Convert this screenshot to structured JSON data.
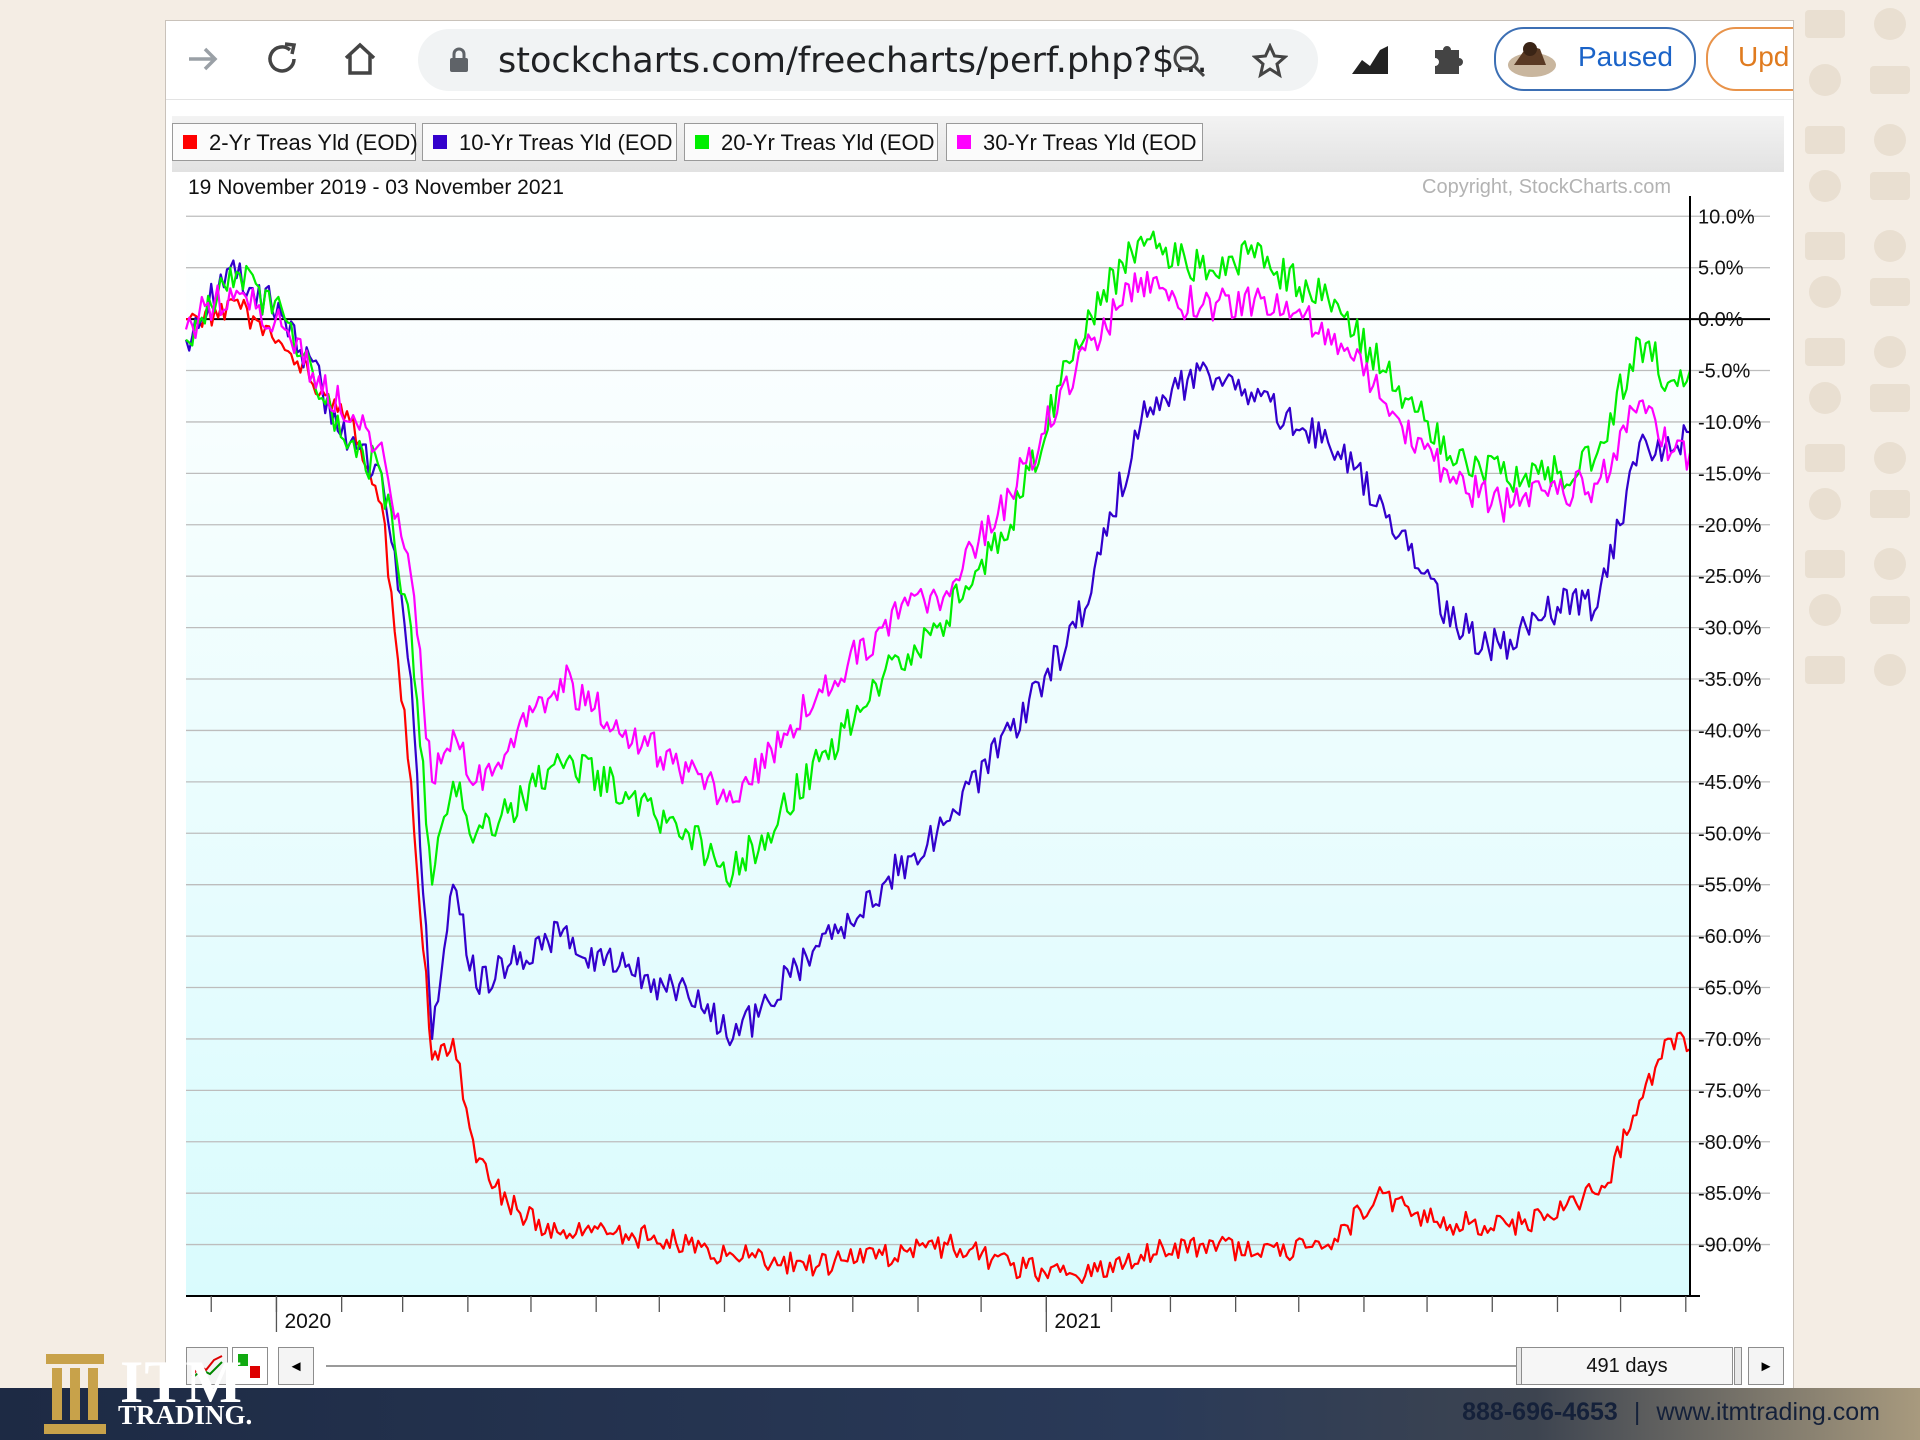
{
  "browser": {
    "url_text": "stockcharts.com/freecharts/perf.php?$...",
    "profile_status": "Paused",
    "update_label": "Upd"
  },
  "chart_data": {
    "type": "line",
    "date_range": "19 November 2019 - 03 November 2021",
    "copyright": "Copyright, StockCharts.com",
    "x_labels": [
      "2020",
      "2021"
    ],
    "yticks": [
      "10.0%",
      "5.0%",
      "0.0%",
      "-5.0%",
      "-10.0%",
      "-15.0%",
      "-20.0%",
      "-25.0%",
      "-30.0%",
      "-35.0%",
      "-40.0%",
      "-45.0%",
      "-50.0%",
      "-55.0%",
      "-60.0%",
      "-65.0%",
      "-70.0%",
      "-75.0%",
      "-80.0%",
      "-85.0%",
      "-90.0%"
    ],
    "ylim": [
      -95,
      11
    ],
    "xlim": [
      "2019-11-19",
      "2021-11-03"
    ],
    "grid": true,
    "series": [
      {
        "name": "2-Yr Treas Yld (EOD)",
        "color": "#ff0000",
        "x": [
          "2019-11-19",
          "2019-12-15",
          "2020-01-05",
          "2020-02-05",
          "2020-02-20",
          "2020-03-05",
          "2020-03-15",
          "2020-03-25",
          "2020-04-05",
          "2020-04-20",
          "2020-05-15",
          "2020-06-15",
          "2020-07-15",
          "2020-08-05",
          "2020-09-15",
          "2020-10-15",
          "2020-11-15",
          "2020-12-15",
          "2021-01-15",
          "2021-02-15",
          "2021-03-15",
          "2021-04-10",
          "2021-05-15",
          "2021-06-10",
          "2021-06-25",
          "2021-07-15",
          "2021-08-15",
          "2021-09-10",
          "2021-09-25",
          "2021-10-10",
          "2021-10-25",
          "2021-11-03"
        ],
        "y": [
          0,
          1,
          -3,
          -10,
          -18,
          -45,
          -72,
          -70,
          -82,
          -86,
          -89,
          -89,
          -90,
          -91,
          -92,
          -91,
          -90,
          -92,
          -93,
          -91,
          -90,
          -91,
          -90,
          -85,
          -87,
          -88,
          -88,
          -86,
          -84,
          -76,
          -70,
          -71
        ]
      },
      {
        "name": "10-Yr Treas Yld (EOD",
        "color": "#3300cc",
        "x": [
          "2019-11-19",
          "2019-12-10",
          "2020-01-05",
          "2020-02-05",
          "2020-02-20",
          "2020-03-05",
          "2020-03-15",
          "2020-03-25",
          "2020-04-05",
          "2020-04-20",
          "2020-05-15",
          "2020-06-15",
          "2020-07-15",
          "2020-08-05",
          "2020-09-15",
          "2020-10-15",
          "2020-11-10",
          "2020-12-15",
          "2021-01-15",
          "2021-02-15",
          "2021-03-15",
          "2021-04-10",
          "2021-05-15",
          "2021-06-10",
          "2021-07-15",
          "2021-08-05",
          "2021-09-01",
          "2021-09-20",
          "2021-10-10",
          "2021-10-25",
          "2021-11-03"
        ],
        "y": [
          -2,
          5,
          0,
          -12,
          -15,
          -35,
          -70,
          -55,
          -65,
          -63,
          -60,
          -63,
          -66,
          -70,
          -61,
          -55,
          -50,
          -40,
          -30,
          -10,
          -5,
          -8,
          -12,
          -18,
          -30,
          -32,
          -28,
          -28,
          -12,
          -13,
          -11
        ]
      },
      {
        "name": "20-Yr Treas Yld (EOD",
        "color": "#00ee00",
        "x": [
          "2019-11-19",
          "2019-12-10",
          "2020-01-05",
          "2020-02-05",
          "2020-02-20",
          "2020-03-05",
          "2020-03-15",
          "2020-03-25",
          "2020-04-05",
          "2020-04-20",
          "2020-05-15",
          "2020-06-15",
          "2020-07-15",
          "2020-08-05",
          "2020-09-15",
          "2020-10-15",
          "2020-11-10",
          "2020-12-15",
          "2021-01-15",
          "2021-02-15",
          "2021-03-15",
          "2021-04-10",
          "2021-05-15",
          "2021-06-10",
          "2021-07-15",
          "2021-08-05",
          "2021-09-01",
          "2021-09-20",
          "2021-10-10",
          "2021-10-25",
          "2021-11-03"
        ],
        "y": [
          -2,
          5,
          0,
          -12,
          -15,
          -30,
          -55,
          -45,
          -50,
          -48,
          -43,
          -46,
          -50,
          -54,
          -43,
          -35,
          -30,
          -20,
          -2,
          8,
          5,
          6,
          2,
          -5,
          -14,
          -15,
          -15,
          -13,
          -2,
          -6,
          -5
        ]
      },
      {
        "name": "30-Yr Treas Yld (EOD",
        "color": "#ff00ff",
        "x": [
          "2019-11-19",
          "2019-12-10",
          "2020-01-05",
          "2020-02-05",
          "2020-02-20",
          "2020-03-05",
          "2020-03-15",
          "2020-03-25",
          "2020-04-05",
          "2020-04-20",
          "2020-05-15",
          "2020-06-15",
          "2020-07-15",
          "2020-08-05",
          "2020-09-15",
          "2020-10-15",
          "2020-11-10",
          "2020-12-15",
          "2021-01-15",
          "2021-02-15",
          "2021-03-15",
          "2021-04-10",
          "2021-05-15",
          "2021-06-10",
          "2021-07-15",
          "2021-08-05",
          "2021-09-01",
          "2021-09-20",
          "2021-10-10",
          "2021-10-25",
          "2021-11-03"
        ],
        "y": [
          -1,
          3,
          -1,
          -10,
          -12,
          -25,
          -45,
          -40,
          -45,
          -42,
          -35,
          -40,
          -44,
          -47,
          -36,
          -30,
          -27,
          -17,
          -5,
          4,
          1,
          2,
          -1,
          -8,
          -16,
          -18,
          -17,
          -16,
          -8,
          -13,
          -13
        ]
      }
    ]
  },
  "navigator": {
    "days_label": "491 days",
    "left_arrow": "◄",
    "right_arrow": "►"
  },
  "footer": {
    "brand": "ITM",
    "brand_sub": "TRADING.",
    "phone": "888-696-4653",
    "separator": "|",
    "website": "www.itmtrading.com"
  }
}
